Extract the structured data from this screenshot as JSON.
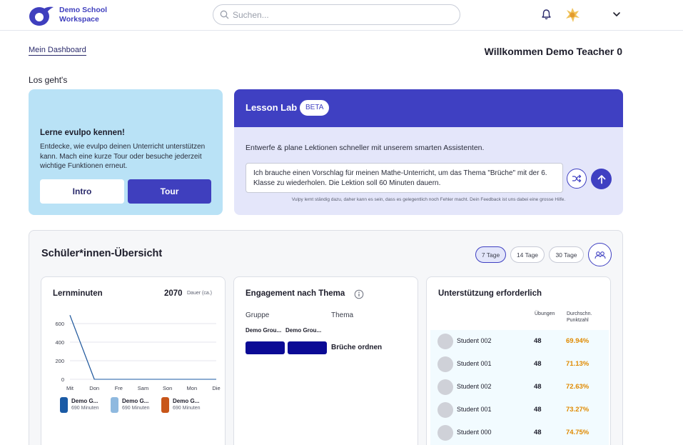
{
  "header": {
    "brand_line1": "Demo School",
    "brand_line2": "Workspace",
    "search_placeholder": "Suchen...",
    "icons": [
      "logo-icon",
      "search-icon",
      "bell-icon",
      "avatar",
      "chevron-down-icon"
    ],
    "colors": {
      "brand": "#3f3fbe"
    }
  },
  "breadcrumb": "Mein Dashboard",
  "welcome": "Willkommen Demo Teacher 0",
  "section_label": "Los geht's",
  "intro_card": {
    "title": "Lerne evulpo kennen!",
    "text": "Entdecke, wie evulpo deinen Unterricht unterstützen kann. Mach eine kurze Tour oder besuche jederzeit wichtige Funktionen erneut.",
    "intro_button": "Intro",
    "tour_button": "Tour",
    "color": "#b9e2f6"
  },
  "lesson_lab": {
    "title": "Lesson Lab",
    "badge": "BETA",
    "description": "Entwerfe & plane Lektionen schneller mit unserem smarten Assistenten.",
    "prompt": "Ich brauche einen Vorschlag für meinen Mathe-Unterricht, um das Thema \"Brüche\" mit der 6. Klasse zu wiederholen. Die Lektion soll 60 Minuten dauern.",
    "note": "Vulpy lernt ständig dazu, daher kann es sein, dass es gelegentlich noch Fehler macht. Dein Feedback ist uns dabei eine grosse Hilfe.",
    "header_color": "#3f40c2"
  },
  "overview": {
    "title": "Schüler*innen-Übersicht",
    "ranges": [
      "7 Tage",
      "14 Tage",
      "30 Tage"
    ],
    "active_range": "7 Tage",
    "learning_minutes": {
      "title": "Lernminuten",
      "total": "2070",
      "total_unit": "Dauer (ca.)",
      "legend": [
        {
          "name": "Demo G...",
          "value": "690 Minuten",
          "color": "#1a5aa5"
        },
        {
          "name": "Demo G...",
          "value": "690 Minuten",
          "color": "#8fb9df"
        },
        {
          "name": "Demo G...",
          "value": "690 Minuten",
          "color": "#c8561a"
        }
      ]
    },
    "engagement": {
      "title": "Engagement nach Thema",
      "col_group": "Gruppe",
      "col_topic": "Thema",
      "groups": [
        "Demo Grou...",
        "Demo Grou..."
      ],
      "topic": "Brüche ordnen",
      "bar_color": "#0b0a95"
    },
    "support": {
      "title": "Unterstützung erforderlich",
      "col_exercises": "Übungen",
      "col_avg_line1": "Durchschn.",
      "col_avg_line2": "Punktzahl",
      "rows": [
        {
          "name": "Student 002",
          "exercises": "48",
          "score": "69.94%"
        },
        {
          "name": "Student 001",
          "exercises": "48",
          "score": "71.13%"
        },
        {
          "name": "Student 002",
          "exercises": "48",
          "score": "72.63%"
        },
        {
          "name": "Student 001",
          "exercises": "48",
          "score": "73.27%"
        },
        {
          "name": "Student 000",
          "exercises": "48",
          "score": "74.75%"
        }
      ],
      "score_color": "#e08a00"
    }
  },
  "chart_data": {
    "type": "line",
    "title": "Lernminuten",
    "categories": [
      "Mit",
      "Don",
      "Fre",
      "Sam",
      "Son",
      "Mon",
      "Die"
    ],
    "y_ticks": [
      "0",
      "200",
      "400",
      "600"
    ],
    "ylim": [
      0,
      700
    ],
    "grid": true,
    "series": [
      {
        "name": "Demo G...",
        "values": [
          690,
          0,
          0,
          0,
          0,
          0,
          0
        ],
        "color": "#1a5aa5"
      },
      {
        "name": "Demo G...",
        "values": [
          690,
          0,
          0,
          0,
          0,
          0,
          0
        ],
        "color": "#8fb9df"
      },
      {
        "name": "Demo G...",
        "values": [
          690,
          0,
          0,
          0,
          0,
          0,
          0
        ],
        "color": "#c8561a"
      }
    ]
  }
}
